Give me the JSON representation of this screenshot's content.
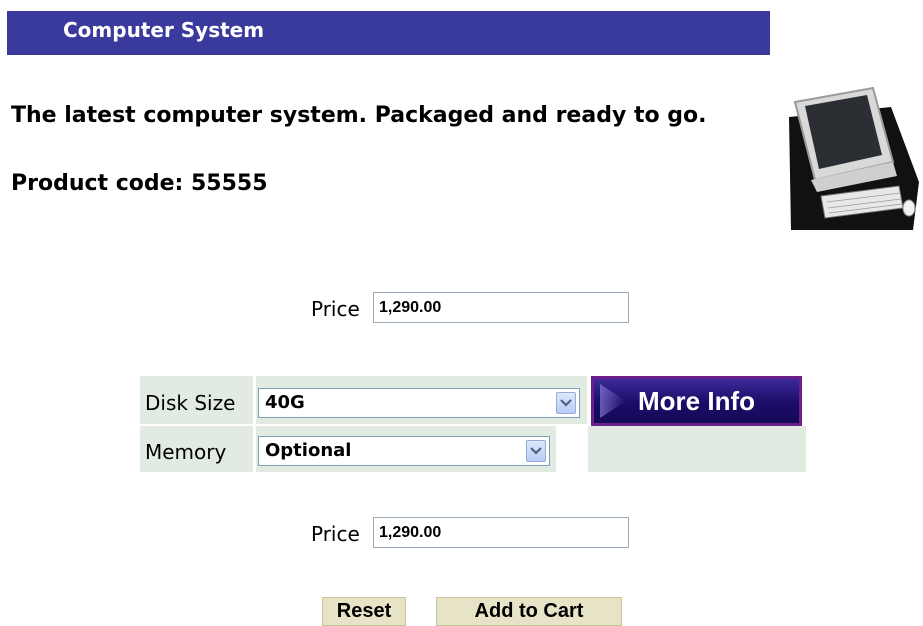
{
  "header": {
    "title": "Computer System"
  },
  "product": {
    "description": "The latest computer system. Packaged and ready to go.",
    "code_text": "Product code: 55555"
  },
  "price_top": {
    "label": "Price",
    "value": "1,290.00"
  },
  "options": {
    "disk": {
      "label": "Disk Size",
      "value": "40G"
    },
    "memory": {
      "label": "Memory",
      "value": "Optional"
    },
    "more_info_label": "More Info"
  },
  "price_bottom": {
    "label": "Price",
    "value": "1,290.00"
  },
  "buttons": {
    "reset": "Reset",
    "add_to_cart": "Add to Cart"
  },
  "colors": {
    "header_bg": "#3a3a9c",
    "options_bg": "#e1ebe1",
    "button_bg": "#e6e3c6"
  }
}
